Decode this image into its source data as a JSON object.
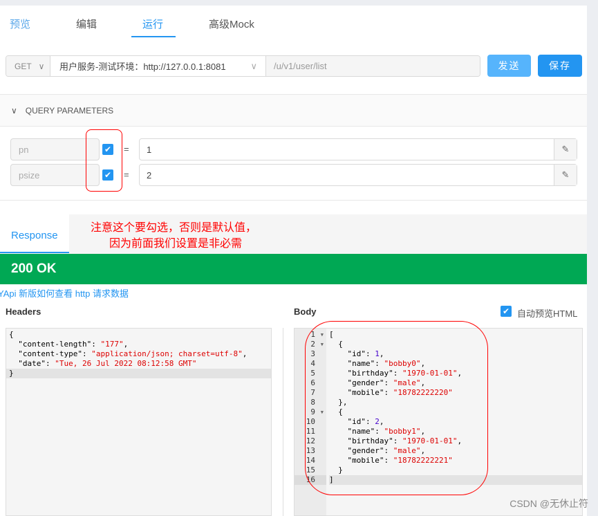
{
  "tabs": [
    {
      "label": "预览"
    },
    {
      "label": "编辑"
    },
    {
      "label": "运行"
    },
    {
      "label": "高级Mock"
    }
  ],
  "request": {
    "method": "GET",
    "env": "用户服务-测试环境：http://127.0.0.1:8081",
    "path": "/u/v1/user/list",
    "send_label": "发送",
    "save_label": "保存"
  },
  "query": {
    "title": "QUERY PARAMETERS",
    "params": [
      {
        "name": "pn",
        "checked": true,
        "value": "1"
      },
      {
        "name": "psize",
        "checked": true,
        "value": "2"
      }
    ],
    "eq": "="
  },
  "annotation": {
    "line1": "注意这个要勾选，否则是默认值，",
    "line2": "因为前面我们设置是非必需"
  },
  "response": {
    "tab": "Response",
    "status": "200 OK",
    "link": "YApi 新版如何查看 http 请求数据",
    "headers_label": "Headers",
    "body_label": "Body",
    "preview_html_label": "自动预览HTML",
    "preview_html_checked": true,
    "headers_lines": [
      "{",
      "  \"content-length\": \"177\",",
      "  \"content-type\": \"application/json; charset=utf-8\",",
      "  \"date\": \"Tue, 26 Jul 2022 08:12:58 GMT\"",
      "}"
    ],
    "body_lines": [
      "[",
      "  {",
      "    \"id\": 1,",
      "    \"name\": \"bobby0\",",
      "    \"birthday\": \"1970-01-01\",",
      "    \"gender\": \"male\",",
      "    \"mobile\": \"18782222220\"",
      "  },",
      "  {",
      "    \"id\": 2,",
      "    \"name\": \"bobby1\",",
      "    \"birthday\": \"1970-01-01\",",
      "    \"gender\": \"male\",",
      "    \"mobile\": \"18782222221\"",
      "  }",
      "]"
    ]
  },
  "watermark": "CSDN @无休止符",
  "colors": {
    "accent": "#2395f1",
    "success": "#00a854",
    "annotation": "#ff0000"
  }
}
